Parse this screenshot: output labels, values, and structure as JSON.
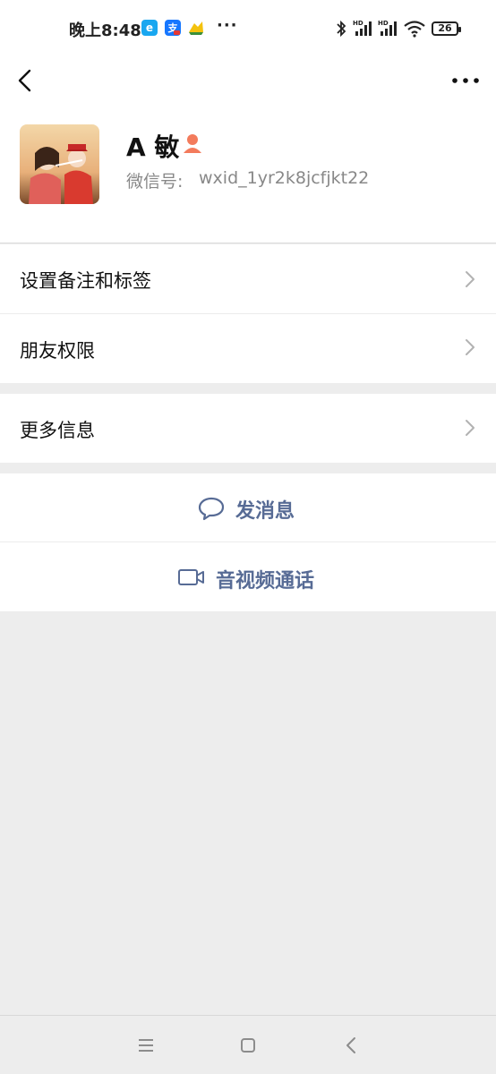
{
  "status_bar": {
    "time": "晚上8:48",
    "dots": "···",
    "battery": "26",
    "icons": [
      "browser-app-icon",
      "alipay-app-icon",
      "yellow-app-icon",
      "bluetooth-icon",
      "signal-hd-icon",
      "signal-hd-icon",
      "wifi-icon",
      "battery-icon"
    ]
  },
  "nav": {
    "back_icon": "chevron-left-icon",
    "more_icon": "more-horizontal-icon"
  },
  "profile": {
    "name": "A 敏",
    "gender_icon": "female-icon",
    "gender_color": "#f37b5c",
    "wxid_label": "微信号:",
    "wxid_value": "wxid_1yr2k8jcfjkt22"
  },
  "menu": {
    "items": [
      {
        "label": "设置备注和标签"
      },
      {
        "label": "朋友权限"
      },
      {
        "label": "更多信息"
      }
    ]
  },
  "actions": {
    "message_label": "发消息",
    "call_label": "音视频通话",
    "link_color": "#576b95"
  },
  "system_nav": {
    "icons": [
      "menu-icon",
      "home-icon",
      "back-icon"
    ]
  }
}
